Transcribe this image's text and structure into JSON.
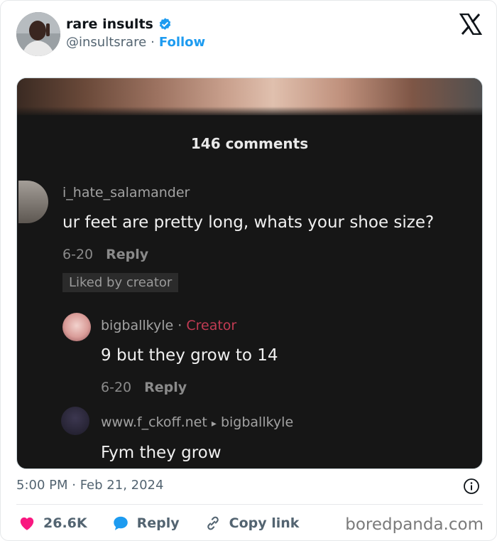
{
  "author": {
    "display_name": "rare insults",
    "handle": "@insultsrare",
    "separator": "·",
    "follow_label": "Follow"
  },
  "media": {
    "comments_count": "146 comments",
    "comments": [
      {
        "username": "i_hate_salamander",
        "text": "ur feet are pretty long, whats your shoe size?",
        "date": "6-20",
        "reply_label": "Reply",
        "badge": "Liked by creator"
      },
      {
        "username": "bigballkyle",
        "role_separator": "·",
        "role": "Creator",
        "text": "9 but they grow to 14",
        "date": "6-20",
        "reply_label": "Reply"
      },
      {
        "username": "www.f_ckoff.net",
        "arrow": "▸",
        "reply_to": "bigballkyle",
        "text": "Fym they grow"
      }
    ]
  },
  "footer": {
    "timestamp": "5:00 PM · Feb 21, 2024",
    "likes": "26.6K",
    "reply_label": "Reply",
    "copy_link_label": "Copy link",
    "watermark": "boredpanda.com"
  },
  "colors": {
    "accent": "#1d9bf0",
    "like": "#f91880",
    "creator": "#c23b53"
  },
  "icons": [
    "verified-badge-icon",
    "x-logo-icon",
    "info-icon",
    "heart-icon",
    "reply-bubble-icon",
    "link-icon"
  ]
}
